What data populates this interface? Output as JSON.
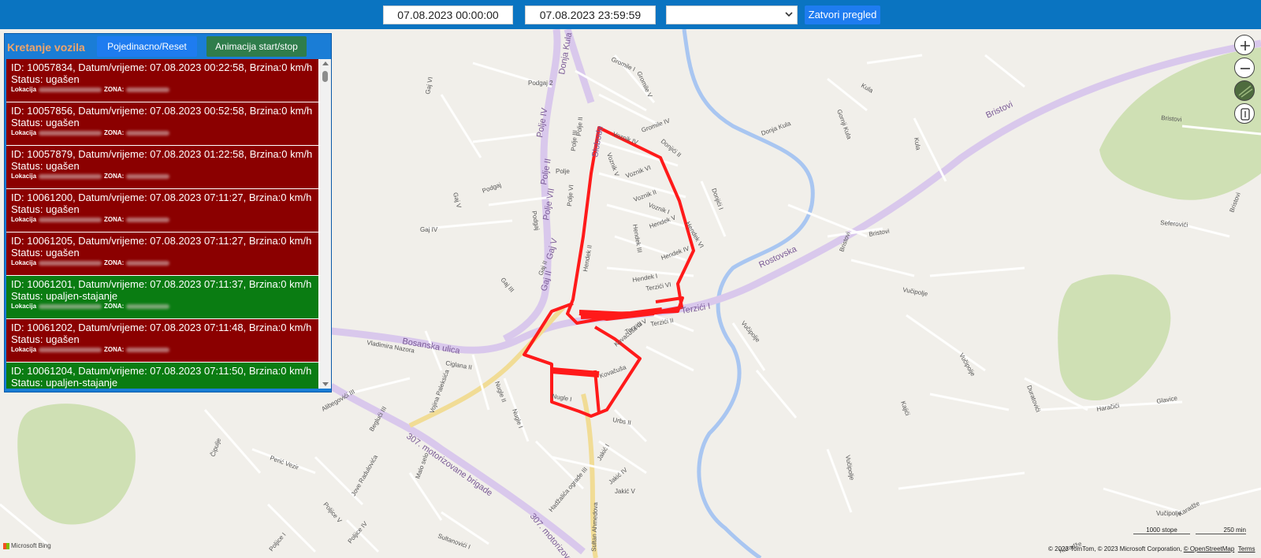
{
  "toolbar": {
    "date_from": "07.08.2023 00:00:00",
    "date_to": "07.08.2023 23:59:59",
    "vehicle_select_value": "",
    "close_button": "Zatvori pregled",
    "bar_color": "#0a74c1"
  },
  "panel": {
    "title": "Kretanje vozila",
    "reset_button": "Pojedinacno/Reset",
    "animation_button": "Animacija start/stop",
    "status_colors": {
      "ugašen": "#8b0000",
      "upaljen-stajanje": "#0a7c12"
    },
    "location_label": "Lokacija",
    "zone_label": "ZONA:",
    "entries": [
      {
        "line": "ID: 10057834, Datum/vrijeme: 07.08.2023 00:22:58, Brzina:0 km/h",
        "status": "Status: ugašen",
        "state": "off"
      },
      {
        "line": "ID: 10057856, Datum/vrijeme: 07.08.2023 00:52:58, Brzina:0 km/h",
        "status": "Status: ugašen",
        "state": "off"
      },
      {
        "line": "ID: 10057879, Datum/vrijeme: 07.08.2023 01:22:58, Brzina:0 km/h",
        "status": "Status: ugašen",
        "state": "off"
      },
      {
        "line": "ID: 10061200, Datum/vrijeme: 07.08.2023 07:11:27, Brzina:0 km/h",
        "status": "Status: ugašen",
        "state": "off"
      },
      {
        "line": "ID: 10061205, Datum/vrijeme: 07.08.2023 07:11:27, Brzina:0 km/h",
        "status": "Status: ugašen",
        "state": "off"
      },
      {
        "line": "ID: 10061201, Datum/vrijeme: 07.08.2023 07:11:37, Brzina:0 km/h",
        "status": "Status: upaljen-stajanje",
        "state": "on"
      },
      {
        "line": "ID: 10061202, Datum/vrijeme: 07.08.2023 07:11:48, Brzina:0 km/h",
        "status": "Status: ugašen",
        "state": "off"
      },
      {
        "line": "ID: 10061204, Datum/vrijeme: 07.08.2023 07:11:50, Brzina:0 km/h",
        "status": "Status: upaljen-stajanje",
        "state": "on"
      }
    ]
  },
  "map": {
    "route_color": "#ff1a1a",
    "labels": {
      "donja_kula": "Donja Kula",
      "gromile_i": "Gromile I",
      "podgaj2": "Podgaj 2",
      "gromile_v": "Gromile V",
      "gromile_iv": "Gromile IV",
      "kula": "Kula",
      "donja_kula2": "Donja Kula",
      "gornji_kula": "Gornji Kula",
      "bristovi": "Bristovi",
      "bristovi2": "Bristovi",
      "gaj_vi": "Gaj VI",
      "polje_iv": "Polje IV",
      "polje_iii": "Polje III",
      "polje_ii": "Polje II",
      "polje": "Polje",
      "polje_vi": "Polje VI",
      "slobode": "Slobode",
      "voznik_iv": "Voznik IV",
      "voznik_v": "Voznik V",
      "voznik_vi": "Voznik VI",
      "voznik_ii": "Voznik II",
      "voznik_i": "Voznik I",
      "donjici_ii": "Donjići II",
      "donjici_i": "Donjići I",
      "gaj_v": "Gaj V",
      "podgaj": "Podgaj",
      "polje_vii": "Polje VII",
      "gaj_iv": "Gaj IV",
      "hendek_iii": "Hendek III",
      "hendek_v": "Hendek V",
      "hendek_vi": "Hendek VI",
      "hendek_iv": "Hendek IV",
      "hendek_i": "Hendek I",
      "hendek_ii": "Hendek II",
      "gaj_ii": "Gaj II",
      "gaj_iii": "Gaj III",
      "terzici_vi": "Terzići VI",
      "terzici_iv": "Terzići IV",
      "terzici_i": "Terzići I",
      "terzici_ii": "Terzići II",
      "terzici_v": "Terzići V",
      "rostovska": "Rostovska",
      "bristovi3": "Bristovi",
      "seferovici": "Seferovići",
      "bristovi4": "Bristovi",
      "vucipolje": "Vučipolje",
      "vucipolje2": "Vučipolje",
      "vucipolje3": "Vučipolje",
      "vucipolje4": "Vučipolje",
      "vucipolje5": "Vučipolje",
      "bosanska": "Bosanska ulica",
      "vladimira": "Vladimira Nazora",
      "ciglana": "Ciglana II",
      "kovacusa": "Kovačuša III",
      "kovacusa2": "Kovačuša",
      "nugle_i": "Nugle I",
      "nugle_ii": "Nugle II",
      "nugle_i2": "Nugle I",
      "jakic_i": "Jakić I",
      "jakic_iv": "Jakić IV",
      "jakic_v": "Jakić V",
      "hadzalica": "Hadžalića ograde III",
      "sultan": "Sultan Ahmedova",
      "brigade": "307. motorizovane brigade",
      "brigade2": "307. motorizovane brigade",
      "brigade3": "307. motorizovane",
      "alibegovici": "Alibegovići III",
      "begluci": "Beglući III",
      "peric": "Perić Vezir",
      "malo_selo": "Malo selo",
      "cipulje": "Čipulje",
      "jove": "Jove Radulovića",
      "poljice_v": "Poljice V",
      "poljice_i": "Poljice I",
      "poljice_iv": "Poljice IV",
      "sultanovici": "Sultanovići I",
      "kajici": "Kajići",
      "duratovici": "Duratovići",
      "glavice": "Glavice",
      "haracici": "Haračići",
      "karadze": "Karadže",
      "karadze2": "Karadže",
      "bristovi5": "Bristovi",
      "vojina": "Vojina Paleksića",
      "urbs": "Urbs II",
      "kovacusa3": "Kovačuša"
    }
  },
  "controls": {
    "zoom_in": "zoom-in",
    "zoom_out": "zoom-out",
    "style": "map-style",
    "legend": "legend"
  },
  "footer": {
    "copyright": "© 2023 TomTom, © 2023 Microsoft Corporation, ",
    "osm": "© OpenStreetMap",
    "terms": "Terms",
    "scale_1": "1000 stope",
    "scale_2": "250 min",
    "logo": "Microsoft Bing"
  }
}
